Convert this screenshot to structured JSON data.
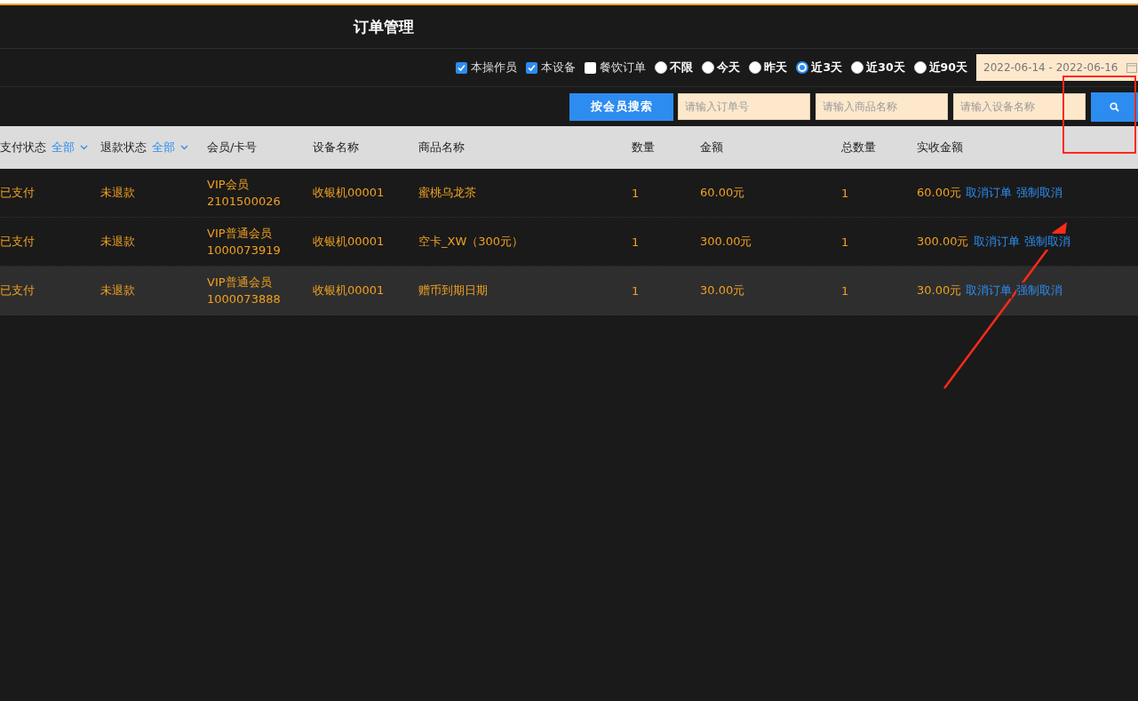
{
  "header": {
    "title": "订单管理"
  },
  "filters": {
    "checkboxes": [
      {
        "label": "本操作员",
        "checked": true
      },
      {
        "label": "本设备",
        "checked": true
      },
      {
        "label": "餐饮订单",
        "checked": false
      }
    ],
    "ranges": [
      {
        "label": "不限",
        "selected": false
      },
      {
        "label": "今天",
        "selected": false
      },
      {
        "label": "昨天",
        "selected": false
      },
      {
        "label": "近3天",
        "selected": true
      },
      {
        "label": "近30天",
        "selected": false
      },
      {
        "label": "近90天",
        "selected": false
      }
    ],
    "date_range": "2022-06-14 - 2022-06-16"
  },
  "search": {
    "member_button": "按会员搜索",
    "fields": [
      {
        "placeholder": "请输入订单号"
      },
      {
        "placeholder": "请输入商品名称"
      },
      {
        "placeholder": "请输入设备名称"
      }
    ]
  },
  "table": {
    "columns": [
      {
        "label": "支付状态",
        "filter": "全部"
      },
      {
        "label": "退款状态",
        "filter": "全部"
      },
      {
        "label": "会员/卡号"
      },
      {
        "label": "设备名称"
      },
      {
        "label": "商品名称"
      },
      {
        "label": "数量"
      },
      {
        "label": "金额"
      },
      {
        "label": "总数量"
      },
      {
        "label": "实收金额"
      }
    ],
    "rows": [
      {
        "highlighted": false,
        "pay_status": "已支付",
        "refund_status": "未退款",
        "member": "VIP会员",
        "card": "2101500026",
        "device": "收银机00001",
        "product": "蜜桃乌龙茶",
        "quantity": "1",
        "amount": "60.00元",
        "total_quantity": "1",
        "received": "60.00元",
        "actions": [
          "取消订单",
          "强制取消"
        ]
      },
      {
        "highlighted": false,
        "pay_status": "已支付",
        "refund_status": "未退款",
        "member": "VIP普通会员",
        "card": "1000073919",
        "device": "收银机00001",
        "product": "空卡_XW（300元）",
        "quantity": "1",
        "amount": "300.00元",
        "total_quantity": "1",
        "received": "300.00元",
        "actions": [
          "取消订单",
          "强制取消"
        ]
      },
      {
        "highlighted": true,
        "pay_status": "已支付",
        "refund_status": "未退款",
        "member": "VIP普通会员",
        "card": "1000073888",
        "device": "收银机00001",
        "product": "赠币到期日期",
        "quantity": "1",
        "amount": "30.00元",
        "total_quantity": "1",
        "received": "30.00元",
        "actions": [
          "取消订单",
          "强制取消"
        ]
      }
    ]
  }
}
